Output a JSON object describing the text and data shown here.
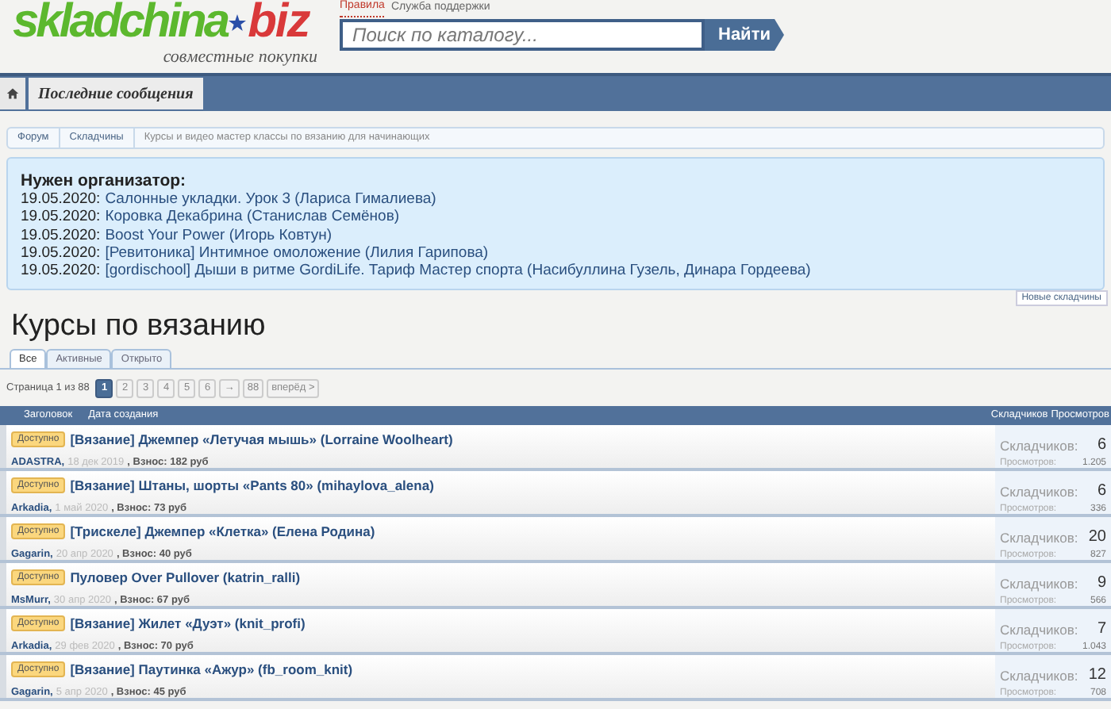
{
  "logo": {
    "name": "skladchina",
    "tld": "biz",
    "tagline": "совместные покупки"
  },
  "top_links": [
    "Правила",
    "Служба поддержки"
  ],
  "search": {
    "placeholder": "Поиск по каталогу...",
    "button": "Найти"
  },
  "nav": {
    "items": [
      "Последние сообщения"
    ]
  },
  "breadcrumbs": [
    "Форум",
    "Складчины",
    "Курсы и видео мастер классы по вязанию для начинающих"
  ],
  "notice": {
    "title": "Нужен организатор:",
    "items": [
      {
        "date": "19.05.2020:",
        "title": "Салонные укладки. Урок 3 (Лариса Гималиева)"
      },
      {
        "date": "19.05.2020:",
        "title": "Коровка Декабрина (Станислав Семёнов)"
      },
      {
        "date": "19.05.2020:",
        "title": "Boost Your Power (Игорь Ковтун)"
      },
      {
        "date": "19.05.2020:",
        "title": "[Ревитоника] Интимное омоложение (Лилия Гарипова)"
      },
      {
        "date": "19.05.2020:",
        "title": "[gordischool] Дыши в ритме GordiLife. Тариф Мастер спорта (Насибуллина Гузель, Динара Гордеева)"
      }
    ]
  },
  "new_button": "Новые складчины",
  "page_title": "Курсы по вязанию",
  "tabs": [
    {
      "label": "Все",
      "selected": true
    },
    {
      "label": "Активные",
      "selected": false
    },
    {
      "label": "Открыто",
      "selected": false
    }
  ],
  "pagination": {
    "summary": "Страница 1 из 88",
    "pages": [
      {
        "label": "1",
        "selected": true
      },
      {
        "label": "2",
        "selected": false
      },
      {
        "label": "3",
        "selected": false
      },
      {
        "label": "4",
        "selected": false
      },
      {
        "label": "5",
        "selected": false
      },
      {
        "label": "6",
        "selected": false
      },
      {
        "label": "→",
        "selected": false
      },
      {
        "label": "88",
        "selected": false
      },
      {
        "label": "вперёд >",
        "selected": false
      }
    ]
  },
  "table": {
    "columns": [
      "Заголовок",
      "Дата создания",
      "Складчиков",
      "Просмотров"
    ],
    "rows": [
      {
        "badge": "Доступно",
        "title": "[Вязание] Джемпер «Летучая мышь» (Lorraine Woolheart)",
        "author": "ADASTRA,",
        "date": "18 дек 2019",
        "fee": ", Взнос: 182 руб",
        "members_label": "Складчиков:",
        "members": "6",
        "views_label": "Просмотров:",
        "views": "1.205"
      },
      {
        "badge": "Доступно",
        "title": "[Вязание] Штаны, шорты «Pants 80» (mihaylova_alena)",
        "author": "Arkadia,",
        "date": "1 май 2020",
        "fee": ", Взнос: 73 руб",
        "members_label": "Складчиков:",
        "members": "6",
        "views_label": "Просмотров:",
        "views": "336"
      },
      {
        "badge": "Доступно",
        "title": "[Трискеле] Джемпер «Клетка» (Елена Родина)",
        "author": "Gagarin,",
        "date": "20 апр 2020",
        "fee": ", Взнос: 40 руб",
        "members_label": "Складчиков:",
        "members": "20",
        "views_label": "Просмотров:",
        "views": "827"
      },
      {
        "badge": "Доступно",
        "title": "Пуловер Over Pullover (katrin_ralli)",
        "author": "MsMurr,",
        "date": "30 апр 2020",
        "fee": ", Взнос: 67 руб",
        "members_label": "Складчиков:",
        "members": "9",
        "views_label": "Просмотров:",
        "views": "566"
      },
      {
        "badge": "Доступно",
        "title": "[Вязание] Жилет «Дуэт» (knit_profi)",
        "author": "Arkadia,",
        "date": "29 фев 2020",
        "fee": ", Взнос: 70 руб",
        "members_label": "Складчиков:",
        "members": "7",
        "views_label": "Просмотров:",
        "views": "1.043"
      },
      {
        "badge": "Доступно",
        "title": "[Вязание] Паутинка «Ажур» (fb_room_knit)",
        "author": "Gagarin,",
        "date": "5 апр 2020",
        "fee": ", Взнос: 45 руб",
        "members_label": "Складчиков:",
        "members": "12",
        "views_label": "Просмотров:",
        "views": "708"
      }
    ]
  }
}
